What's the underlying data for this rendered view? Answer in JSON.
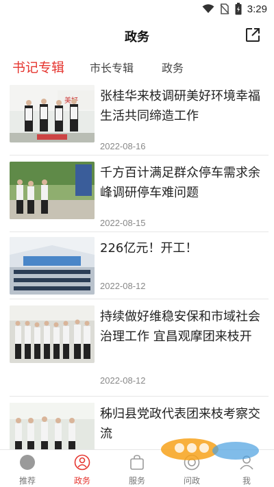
{
  "status_bar": {
    "time": "3:29"
  },
  "header": {
    "title": "政务",
    "share_icon": "external-link-icon"
  },
  "tabs": [
    {
      "label": "书记专辑",
      "active": true
    },
    {
      "label": "市长专辑",
      "active": false
    },
    {
      "label": "政务",
      "active": false
    }
  ],
  "news": [
    {
      "title": "张桂华来枝调研美好环境幸福生活共同缔造工作",
      "date": "2022-08-16"
    },
    {
      "title": "千方百计满足群众停车需求余峰调研停车难问题",
      "date": "2022-08-15"
    },
    {
      "title": "226亿元！开工！",
      "date": "2022-08-12"
    },
    {
      "title": "持续做好维稳安保和市域社会治理工作 宜昌观摩团来枝开",
      "date": "2022-08-12"
    },
    {
      "title": "秭归县党政代表团来枝考察交流",
      "date": ""
    }
  ],
  "bottom_nav": [
    {
      "label": "推荐",
      "icon": "home-circle-icon",
      "active": false
    },
    {
      "label": "政务",
      "icon": "government-icon",
      "active": true
    },
    {
      "label": "服务",
      "icon": "bag-icon",
      "active": false
    },
    {
      "label": "问政",
      "icon": "question-icon",
      "active": false
    },
    {
      "label": "我",
      "icon": "user-icon",
      "active": false
    }
  ],
  "colors": {
    "accent": "#e5352f",
    "text": "#222222",
    "muted": "#888888"
  }
}
